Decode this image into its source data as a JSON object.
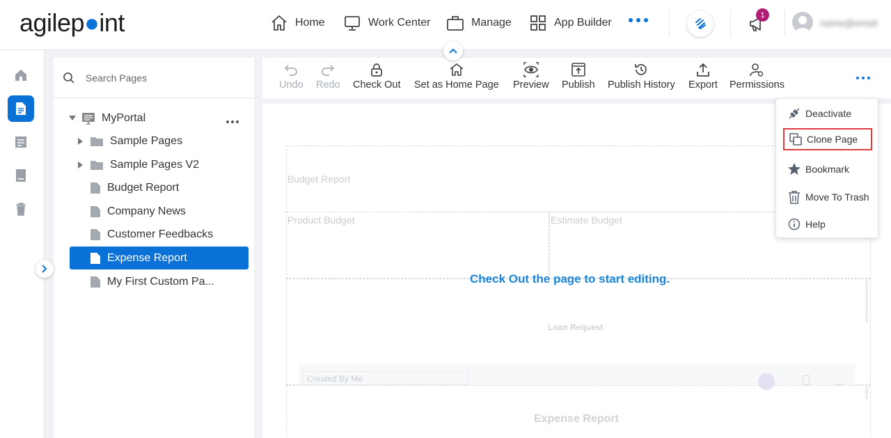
{
  "app": {
    "logo_text_a": "agilep",
    "logo_text_b": "int"
  },
  "nav": {
    "items": [
      {
        "label": "Home",
        "icon": "home-icon"
      },
      {
        "label": "Work Center",
        "icon": "monitor-icon"
      },
      {
        "label": "Manage",
        "icon": "briefcase-icon"
      },
      {
        "label": "App Builder",
        "icon": "grid-icon"
      }
    ],
    "notification_count": "1",
    "username": "name@email"
  },
  "search": {
    "placeholder": "Search Pages"
  },
  "tree": {
    "root": "MyPortal",
    "items": [
      {
        "label": "Sample Pages",
        "type": "folder"
      },
      {
        "label": "Sample Pages V2",
        "type": "folder"
      },
      {
        "label": "Budget Report",
        "type": "page"
      },
      {
        "label": "Company News",
        "type": "page"
      },
      {
        "label": "Customer Feedbacks",
        "type": "page"
      },
      {
        "label": "Expense Report",
        "type": "page",
        "selected": true
      },
      {
        "label": "My First Custom Pa...",
        "type": "page"
      }
    ]
  },
  "toolbar": {
    "undo": "Undo",
    "redo": "Redo",
    "check_out": "Check Out",
    "set_home": "Set as Home Page",
    "preview": "Preview",
    "publish": "Publish",
    "publish_history": "Publish History",
    "export": "Export",
    "permissions": "Permissions"
  },
  "menu": {
    "deactivate": "Deactivate",
    "clone_page": "Clone Page",
    "bookmark": "Bookmark",
    "move_to_trash": "Move To Trash",
    "help": "Help"
  },
  "canvas": {
    "message": "Check Out the page to start editing.",
    "widget_budget_report": "Budget Report",
    "widget_product_budget": "Product Budget",
    "widget_estimate_budget": "Estimate Budget",
    "widget_loan_request": "Loan Request",
    "widget_filter": "Created By Me",
    "widget_expense_report": "Expense Report"
  },
  "colors": {
    "accent": "#0a72d6",
    "badge": "#b01e73",
    "highlight_border": "#e0393e"
  }
}
